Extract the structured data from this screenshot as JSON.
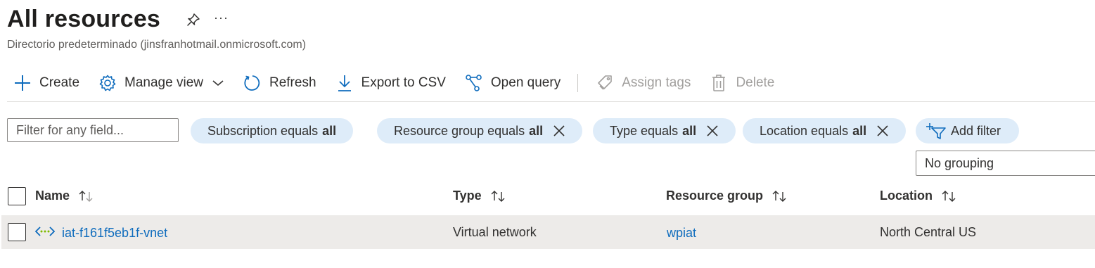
{
  "header": {
    "title": "All resources",
    "more": "···",
    "subtitle": "Directorio predeterminado (jinsfranhotmail.onmicrosoft.com)"
  },
  "toolbar": {
    "create": "Create",
    "manage_view": "Manage view",
    "refresh": "Refresh",
    "export": "Export to CSV",
    "open_query": "Open query",
    "assign_tags": "Assign tags",
    "delete": "Delete"
  },
  "filters": {
    "search_placeholder": "Filter for any field...",
    "subscription": {
      "label": "Subscription equals",
      "value": "all"
    },
    "resource_group": {
      "label": "Resource group equals",
      "value": "all"
    },
    "type": {
      "label": "Type equals",
      "value": "all"
    },
    "location": {
      "label": "Location equals",
      "value": "all"
    },
    "add_filter": "Add filter",
    "grouping": "No grouping"
  },
  "table": {
    "columns": {
      "name": "Name",
      "type": "Type",
      "resource_group": "Resource group",
      "location": "Location"
    },
    "rows": [
      {
        "name": "iat-f161f5eb1f-vnet",
        "type": "Virtual network",
        "resource_group": "wpiat",
        "location": "North Central US"
      }
    ]
  },
  "colors": {
    "accent": "#0f6cbd",
    "pill_bg": "#deecf9",
    "row_selected_bg": "#edebe9"
  }
}
